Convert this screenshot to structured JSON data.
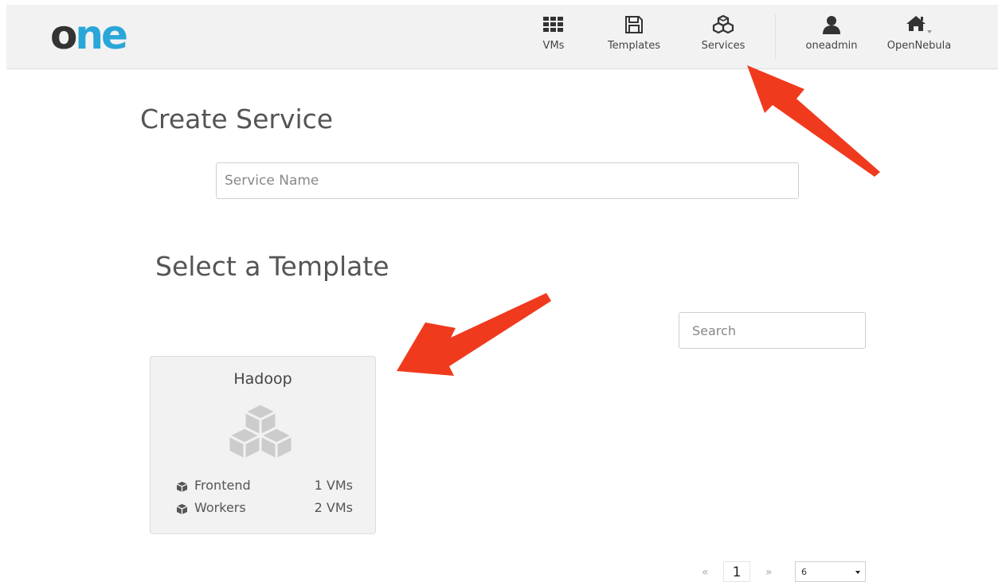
{
  "header": {
    "logo": {
      "part1": "o",
      "part2": "ne"
    },
    "nav": [
      {
        "label": "VMs",
        "icon": "grid-icon"
      },
      {
        "label": "Templates",
        "icon": "save-icon"
      },
      {
        "label": "Services",
        "icon": "cubes-icon"
      },
      {
        "label": "oneadmin",
        "icon": "user-icon"
      },
      {
        "label": "OpenNebula",
        "icon": "home-icon"
      }
    ]
  },
  "create": {
    "heading": "Create Service",
    "name_placeholder": "Service Name"
  },
  "select": {
    "heading": "Select a Template",
    "search_placeholder": "Search"
  },
  "templates": [
    {
      "name": "Hadoop",
      "icon": "cubes-icon",
      "roles": [
        {
          "name": "Frontend",
          "vms": "1 VMs",
          "icon": "cube-icon"
        },
        {
          "name": "Workers",
          "vms": "2 VMs",
          "icon": "cube-icon"
        }
      ]
    }
  ],
  "pagination": {
    "prev": "«",
    "current": "1",
    "next": "»",
    "page_size": "6"
  },
  "colors": {
    "logo_dark": "#333333",
    "logo_accent": "#2aa6d8",
    "annotation_arrow": "#f03a1e",
    "header_bg": "#f2f2f2"
  }
}
